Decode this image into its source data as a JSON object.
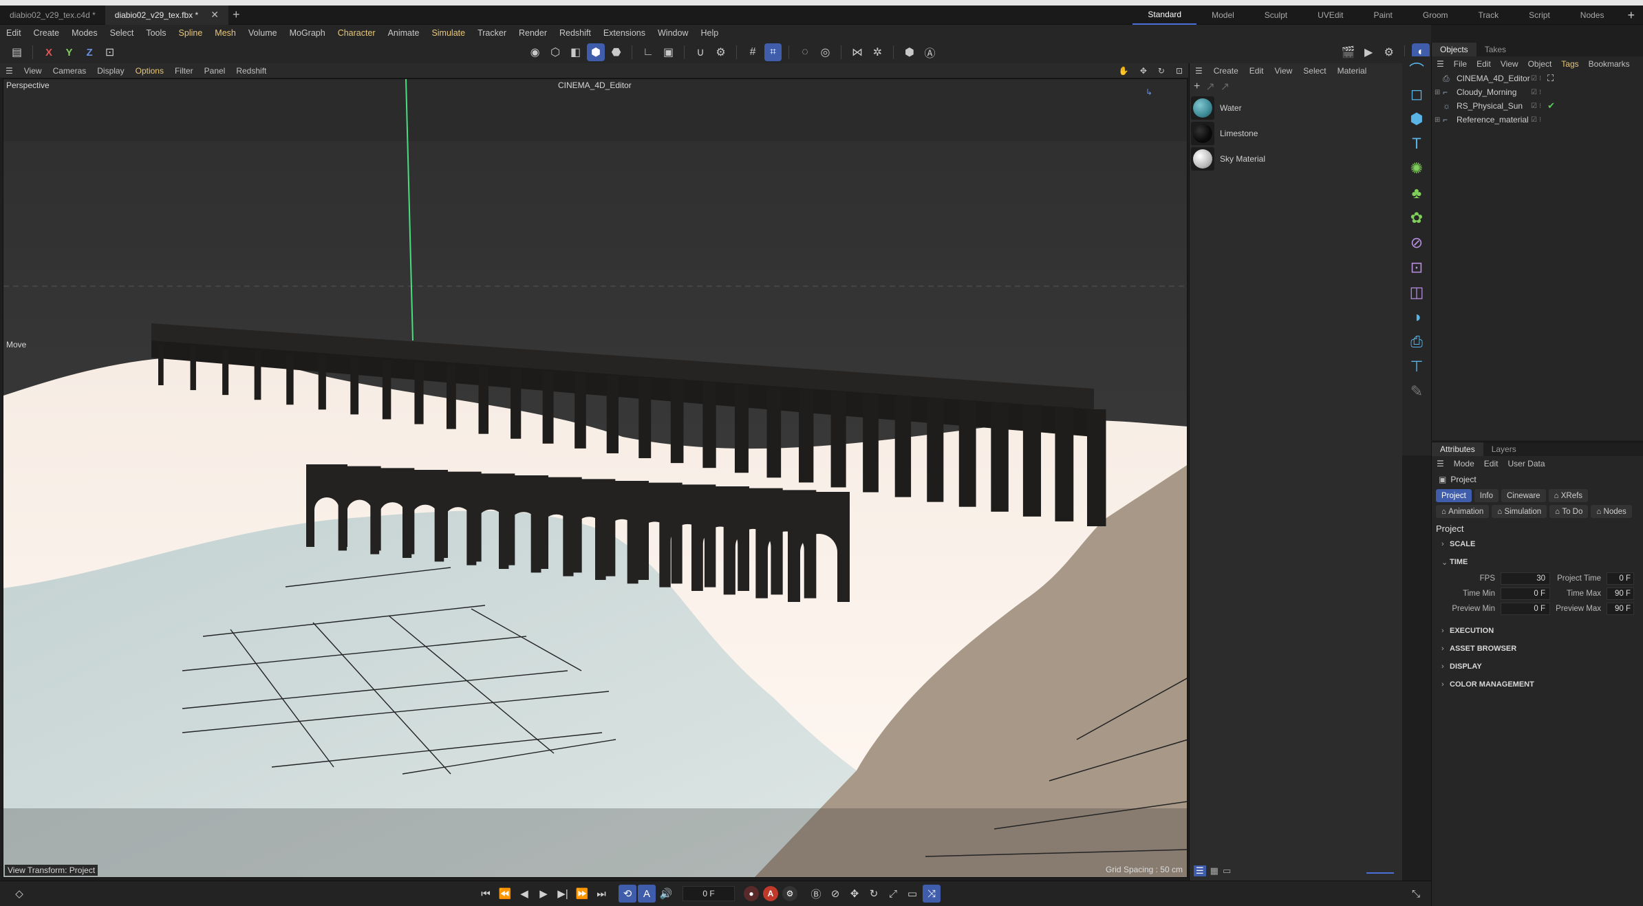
{
  "tabs": [
    {
      "label": "diabio02_v29_tex.c4d *"
    },
    {
      "label": "diabio02_v29_tex.fbx *"
    }
  ],
  "layouts": [
    "Standard",
    "Model",
    "Sculpt",
    "UVEdit",
    "Paint",
    "Groom",
    "Track",
    "Script",
    "Nodes"
  ],
  "menu": [
    {
      "label": "Edit"
    },
    {
      "label": "Create"
    },
    {
      "label": "Modes"
    },
    {
      "label": "Select"
    },
    {
      "label": "Tools"
    },
    {
      "label": "Spline"
    },
    {
      "label": "Mesh"
    },
    {
      "label": "Volume"
    },
    {
      "label": "MoGraph"
    },
    {
      "label": "Character"
    },
    {
      "label": "Animate"
    },
    {
      "label": "Simulate"
    },
    {
      "label": "Tracker"
    },
    {
      "label": "Render"
    },
    {
      "label": "Redshift"
    },
    {
      "label": "Extensions"
    },
    {
      "label": "Window"
    },
    {
      "label": "Help"
    }
  ],
  "toolbar": {
    "axis_x": "X",
    "axis_y": "Y",
    "axis_z": "Z"
  },
  "viewport_menu": [
    "View",
    "Cameras",
    "Display",
    "Options",
    "Filter",
    "Panel",
    "Redshift"
  ],
  "viewport": {
    "name": "Perspective",
    "camera": "CINEMA_4D_Editor",
    "tool": "Move",
    "view_transform": "View Transform: Project",
    "grid_spacing": "Grid Spacing : 50 cm"
  },
  "materials": {
    "menu": [
      "Create",
      "Edit",
      "View",
      "Select",
      "Material"
    ],
    "items": [
      {
        "name": "Water",
        "color": "#3e8a96"
      },
      {
        "name": "Limestone",
        "color": "#0a0a0a"
      },
      {
        "name": "Sky Material",
        "color": "#d8d8d8"
      }
    ]
  },
  "objects": {
    "tabs": [
      "Objects",
      "Takes"
    ],
    "menu": [
      "File",
      "Edit",
      "View",
      "Object",
      "Tags",
      "Bookmarks"
    ],
    "items": [
      {
        "name": "CINEMA_4D_Editor"
      },
      {
        "name": "Cloudy_Morning"
      },
      {
        "name": "RS_Physical_Sun"
      },
      {
        "name": "Reference_material"
      }
    ]
  },
  "attributes": {
    "tabs": [
      "Attributes",
      "Layers"
    ],
    "menu": [
      "Mode",
      "Edit",
      "User Data"
    ],
    "object_type": "Project",
    "chips": [
      "Project",
      "Info",
      "Cineware",
      "XRefs",
      "Animation",
      "Simulation",
      "To Do",
      "Nodes"
    ],
    "section_title": "Project",
    "sections_before": [
      "SCALE"
    ],
    "time_section": "TIME",
    "fps_label": "FPS",
    "fps": "30",
    "project_time_label": "Project Time",
    "project_time": "0 F",
    "time_min_label": "Time Min",
    "time_min": "0 F",
    "time_max_label": "Time Max",
    "time_max": "90 F",
    "preview_min_label": "Preview Min",
    "preview_min": "0 F",
    "preview_max_label": "Preview Max",
    "preview_max": "90 F",
    "sections_after": [
      "EXECUTION",
      "ASSET BROWSER",
      "DISPLAY",
      "COLOR MANAGEMENT"
    ]
  },
  "timeline": {
    "current_frame": "0 F",
    "autokey_label": "A"
  },
  "colors": {
    "accent": "#3f5dab",
    "highlight_text": "#e8c87a",
    "icon_blue": "#5ab4e6"
  }
}
